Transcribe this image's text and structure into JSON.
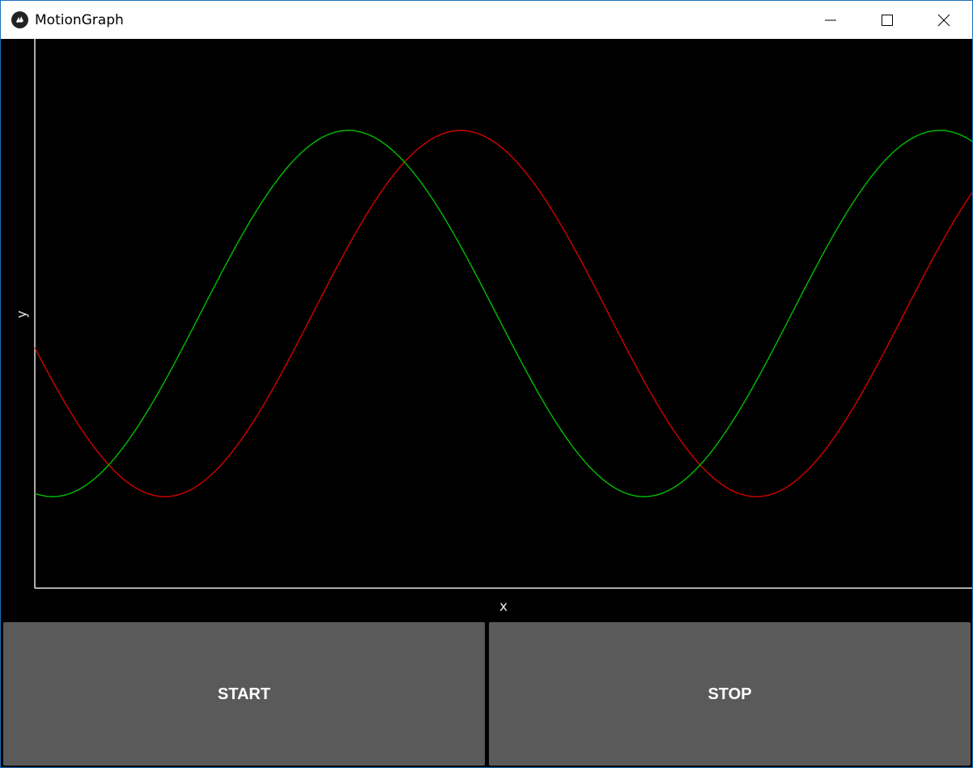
{
  "window": {
    "title": "MotionGraph",
    "icon": "kivy-logo-icon",
    "controls": [
      "minimize-icon",
      "maximize-icon",
      "close-icon"
    ]
  },
  "graph": {
    "xlabel": "x",
    "ylabel": "y",
    "background": "#000000",
    "axis_color": "#e6e6e6"
  },
  "chart_data": {
    "type": "line",
    "title": "",
    "xlabel": "x",
    "ylabel": "y",
    "grid": false,
    "ylim": [
      -1.5,
      1.5
    ],
    "xlim": [
      0,
      1
    ],
    "series": [
      {
        "color": "#d40000",
        "function": "cos",
        "periods_visible": 3.17,
        "phase_start": 0.56,
        "amplitude": 1
      },
      {
        "color": "#00c000",
        "function": "sin",
        "periods_visible": 3.17,
        "phase_start": -0.56,
        "amplitude": 1
      }
    ]
  },
  "buttons": {
    "start_label": "START",
    "stop_label": "STOP",
    "color": "#5a5a5a"
  }
}
